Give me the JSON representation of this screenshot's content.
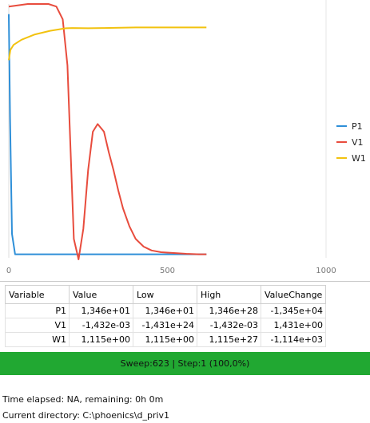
{
  "chart_data": {
    "type": "line",
    "x_ticks": [
      "0",
      "500",
      "1000"
    ],
    "xlim": [
      0,
      1000
    ],
    "ylim": [
      0,
      1
    ],
    "grid": false,
    "legend_position": "right",
    "series": [
      {
        "name": "P1",
        "color": "#2e8fd8",
        "x": [
          0,
          4,
          10,
          20,
          50,
          100,
          200,
          300,
          400,
          500,
          600,
          623
        ],
        "y": [
          0.96,
          0.55,
          0.1,
          0.02,
          0.02,
          0.02,
          0.02,
          0.02,
          0.02,
          0.02,
          0.02,
          0.02
        ]
      },
      {
        "name": "V1",
        "color": "#e84c3d",
        "x": [
          0,
          60,
          90,
          125,
          150,
          170,
          185,
          195,
          205,
          220,
          235,
          250,
          265,
          280,
          300,
          315,
          330,
          345,
          360,
          380,
          400,
          425,
          450,
          480,
          520,
          560,
          600,
          623
        ],
        "y": [
          0.99,
          1.0,
          1.0,
          1.0,
          0.99,
          0.94,
          0.76,
          0.42,
          0.08,
          0.0,
          0.12,
          0.35,
          0.5,
          0.53,
          0.5,
          0.42,
          0.35,
          0.27,
          0.2,
          0.13,
          0.08,
          0.05,
          0.035,
          0.028,
          0.025,
          0.022,
          0.02,
          0.02
        ]
      },
      {
        "name": "W1",
        "color": "#f2c20f",
        "x": [
          0,
          5,
          15,
          40,
          80,
          130,
          180,
          200,
          250,
          300,
          400,
          500,
          600,
          623
        ],
        "y": [
          0.78,
          0.82,
          0.84,
          0.86,
          0.88,
          0.895,
          0.905,
          0.906,
          0.905,
          0.906,
          0.908,
          0.908,
          0.908,
          0.908
        ]
      }
    ]
  },
  "table": {
    "headers": [
      "Variable",
      "Value",
      "Low",
      "High",
      "ValueChange"
    ],
    "rows": [
      [
        "P1",
        "1,346e+01",
        "1,346e+01",
        "1,346e+28",
        "-1,345e+04"
      ],
      [
        "V1",
        "-1,432e-03",
        "-1,431e+24",
        "-1,432e-03",
        "1,431e+00"
      ],
      [
        "W1",
        "1,115e+00",
        "1,115e+00",
        "1,115e+27",
        "-1,114e+03"
      ]
    ]
  },
  "status": {
    "text": "Sweep:623 | Step:1  (100,0%)",
    "color": "#21a832"
  },
  "info": {
    "time_elapsed": "Time elapsed: NA, remaining: 0h 0m",
    "current_directory": "Current directory:  C:\\phoenics\\d_priv1"
  }
}
